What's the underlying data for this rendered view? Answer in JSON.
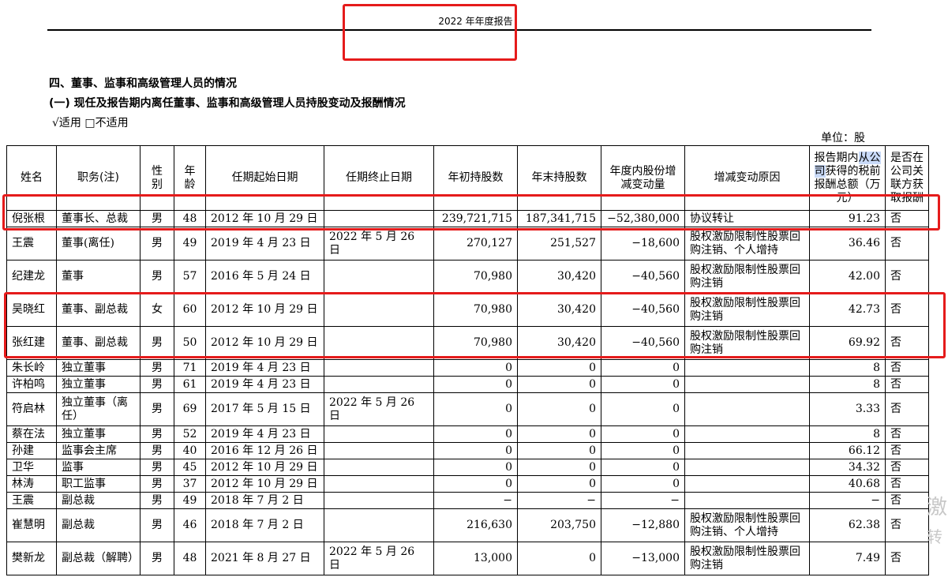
{
  "header": {
    "title": "2022 年年度报告"
  },
  "section": {
    "title": "四、董事、监事和高级管理人员的情况",
    "subtitle": "(一)  现任及报告期内离任董事、监事和高级管理人员持股变动及报酬情况",
    "applicability": "√适用  □不适用",
    "unit": "单位：股"
  },
  "table": {
    "headers": {
      "name": "姓名",
      "position": "职务(注)",
      "gender": "性别",
      "age": "年龄",
      "start": "任期起始日期",
      "end": "任期终止日期",
      "begin_shares": "年初持股数",
      "end_shares": "年末持股数",
      "change": "年度内股份增减变动量",
      "reason": "增减变动原因",
      "pay_prefix": "报告期内",
      "pay_hl": "从公司",
      "pay_suffix": "获得的税前报酬总额（万元）",
      "related": "是否在公司关联方获取报酬"
    },
    "rows": [
      {
        "name": "倪张根",
        "position": "董事长、总裁",
        "gender": "男",
        "age": "48",
        "start": "2012 年 10 月 29 日",
        "end": "",
        "begin": "239,721,715",
        "endn": "187,341,715",
        "change": "−52,380,000",
        "reason": "协议转让",
        "pay": "91.23",
        "related": "否"
      },
      {
        "name": "王震",
        "position": "董事(离任)",
        "gender": "男",
        "age": "49",
        "start": "2019 年 4 月 23 日",
        "end": "2022 年 5 月 26 日",
        "begin": "270,127",
        "endn": "251,527",
        "change": "−18,600",
        "reason": "股权激励限制性股票回购注销、个人增持",
        "pay": "36.46",
        "related": "否"
      },
      {
        "name": "纪建龙",
        "position": "董事",
        "gender": "男",
        "age": "57",
        "start": "2016 年 5 月 24 日",
        "end": "",
        "begin": "70,980",
        "endn": "30,420",
        "change": "−40,560",
        "reason": "股权激励限制性股票回购注销",
        "pay": "42.00",
        "related": "否"
      },
      {
        "name": "吴晓红",
        "position": "董事、副总裁",
        "gender": "女",
        "age": "60",
        "start": "2012 年 10 月 29 日",
        "end": "",
        "begin": "70,980",
        "endn": "30,420",
        "change": "−40,560",
        "reason": "股权激励限制性股票回购注销",
        "pay": "42.73",
        "related": "否"
      },
      {
        "name": "张红建",
        "position": "董事、副总裁",
        "gender": "男",
        "age": "50",
        "start": "2012 年 10 月 29 日",
        "end": "",
        "begin": "70,980",
        "endn": "30,420",
        "change": "−40,560",
        "reason": "股权激励限制性股票回购注销",
        "pay": "69.92",
        "related": "否"
      },
      {
        "name": "朱长岭",
        "position": "独立董事",
        "gender": "男",
        "age": "71",
        "start": "2019 年 4 月 23 日",
        "end": "",
        "begin": "0",
        "endn": "0",
        "change": "0",
        "reason": "",
        "pay": "8",
        "related": "否"
      },
      {
        "name": "许柏鸣",
        "position": "独立董事",
        "gender": "男",
        "age": "61",
        "start": "2019 年 4 月 23 日",
        "end": "",
        "begin": "0",
        "endn": "0",
        "change": "0",
        "reason": "",
        "pay": "8",
        "related": "否"
      },
      {
        "name": "符启林",
        "position": "独立董事（离任）",
        "gender": "男",
        "age": "69",
        "start": "2017 年 5 月 15 日",
        "end": "2022 年 5 月 26 日",
        "begin": "0",
        "endn": "0",
        "change": "0",
        "reason": "",
        "pay": "3.33",
        "related": "否"
      },
      {
        "name": "蔡在法",
        "position": "独立董事",
        "gender": "男",
        "age": "52",
        "start": "2019 年 4 月 23 日",
        "end": "",
        "begin": "0",
        "endn": "0",
        "change": "0",
        "reason": "",
        "pay": "8",
        "related": "否"
      },
      {
        "name": "孙建",
        "position": "监事会主席",
        "gender": "男",
        "age": "40",
        "start": "2016 年 12 月 26 日",
        "end": "",
        "begin": "0",
        "endn": "0",
        "change": "0",
        "reason": "",
        "pay": "66.12",
        "related": "否"
      },
      {
        "name": "卫华",
        "position": "监事",
        "gender": "男",
        "age": "45",
        "start": "2012 年 10 月 29 日",
        "end": "",
        "begin": "0",
        "endn": "0",
        "change": "0",
        "reason": "",
        "pay": "34.32",
        "related": "否"
      },
      {
        "name": "林涛",
        "position": "职工监事",
        "gender": "男",
        "age": "37",
        "start": "2012 年 10 月 29 日",
        "end": "",
        "begin": "0",
        "endn": "0",
        "change": "0",
        "reason": "",
        "pay": "40.68",
        "related": "否"
      },
      {
        "name": "王震",
        "position": "副总裁",
        "gender": "男",
        "age": "49",
        "start": "2018 年 7 月 2 日",
        "end": "",
        "begin": "−",
        "endn": "−",
        "change": "−",
        "reason": "",
        "pay": "−",
        "related": "否"
      },
      {
        "name": "崔慧明",
        "position": "副总裁",
        "gender": "男",
        "age": "46",
        "start": "2018 年 7 月 2 日",
        "end": "",
        "begin": "216,630",
        "endn": "203,750",
        "change": "−12,880",
        "reason": "股权激励限制性股票回购注销、个人增持",
        "pay": "62.38",
        "related": "否"
      },
      {
        "name": "樊新龙",
        "position": "副总裁（解聘）",
        "gender": "男",
        "age": "48",
        "start": "2021 年 8 月 27 日",
        "end": "2022 年 5 月 26 日",
        "begin": "13,000",
        "endn": "0",
        "change": "−13,000",
        "reason": "股权激励限制性股票回购注销",
        "pay": "7.49",
        "related": "否"
      }
    ]
  },
  "watermark": {
    "line1": "激",
    "line2": "转"
  },
  "colors": {
    "annotation": "#e51b1b",
    "highlight": "#c9daf8"
  }
}
